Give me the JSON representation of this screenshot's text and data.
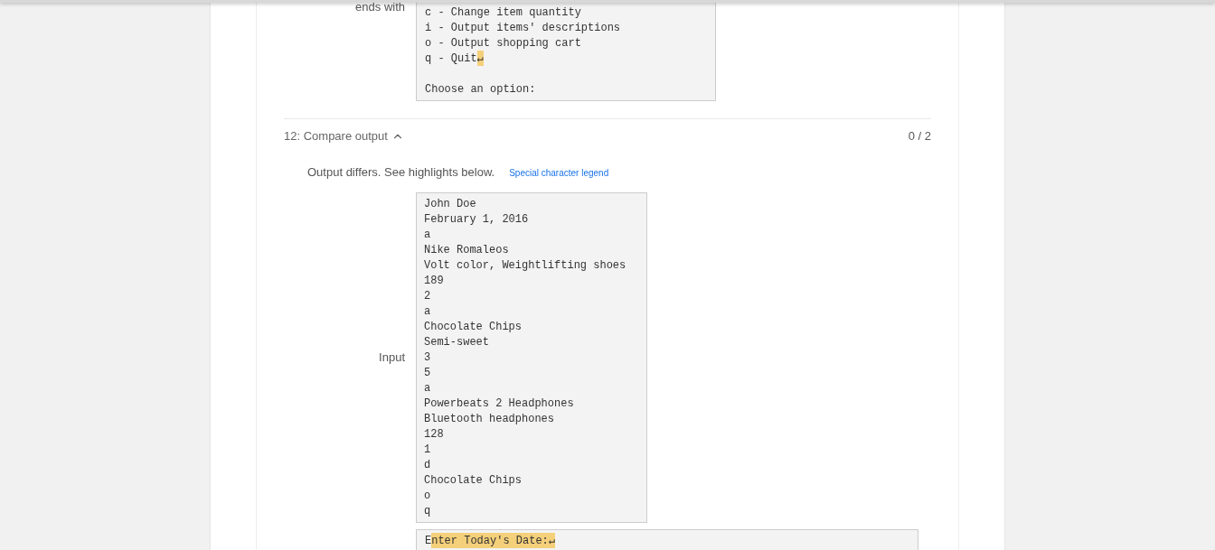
{
  "expected": {
    "label": "ends with",
    "lines": [
      {
        "kind": "text",
        "segments": [
          {
            "text": "c - Change item quantity",
            "highlighted": false
          }
        ]
      },
      {
        "kind": "text",
        "segments": [
          {
            "text": "i - Output items' descriptions",
            "highlighted": false
          }
        ]
      },
      {
        "kind": "text",
        "segments": [
          {
            "text": "o - Output shopping cart",
            "highlighted": false
          }
        ]
      },
      {
        "kind": "text",
        "segments": [
          {
            "text": "q - Quit",
            "highlighted": false
          },
          {
            "text": "↵",
            "highlighted": true
          }
        ]
      },
      {
        "kind": "blank"
      },
      {
        "kind": "text",
        "segments": [
          {
            "text": "Choose an option:",
            "highlighted": false
          }
        ]
      }
    ]
  },
  "compare": {
    "title": "12: Compare output",
    "expanded": true,
    "score": "0 / 2",
    "message": "Output differs. See highlights below.",
    "legend_link": "Special character legend",
    "input": {
      "label": "Input",
      "lines": [
        "John Doe",
        "February 1, 2016",
        "a",
        "Nike Romaleos",
        "Volt color, Weightlifting shoes",
        "189",
        "2",
        "a",
        "Chocolate Chips",
        "Semi-sweet",
        "3",
        "5",
        "a",
        "Powerbeats 2 Headphones",
        "Bluetooth headphones",
        "128",
        "1",
        "d",
        "Chocolate Chips",
        "o",
        "q"
      ]
    },
    "output": {
      "lines": [
        {
          "kind": "text",
          "segments": [
            {
              "text": "E",
              "highlighted": false
            },
            {
              "text": "nter Today's Date:↵",
              "highlighted": true
            }
          ]
        }
      ]
    }
  }
}
